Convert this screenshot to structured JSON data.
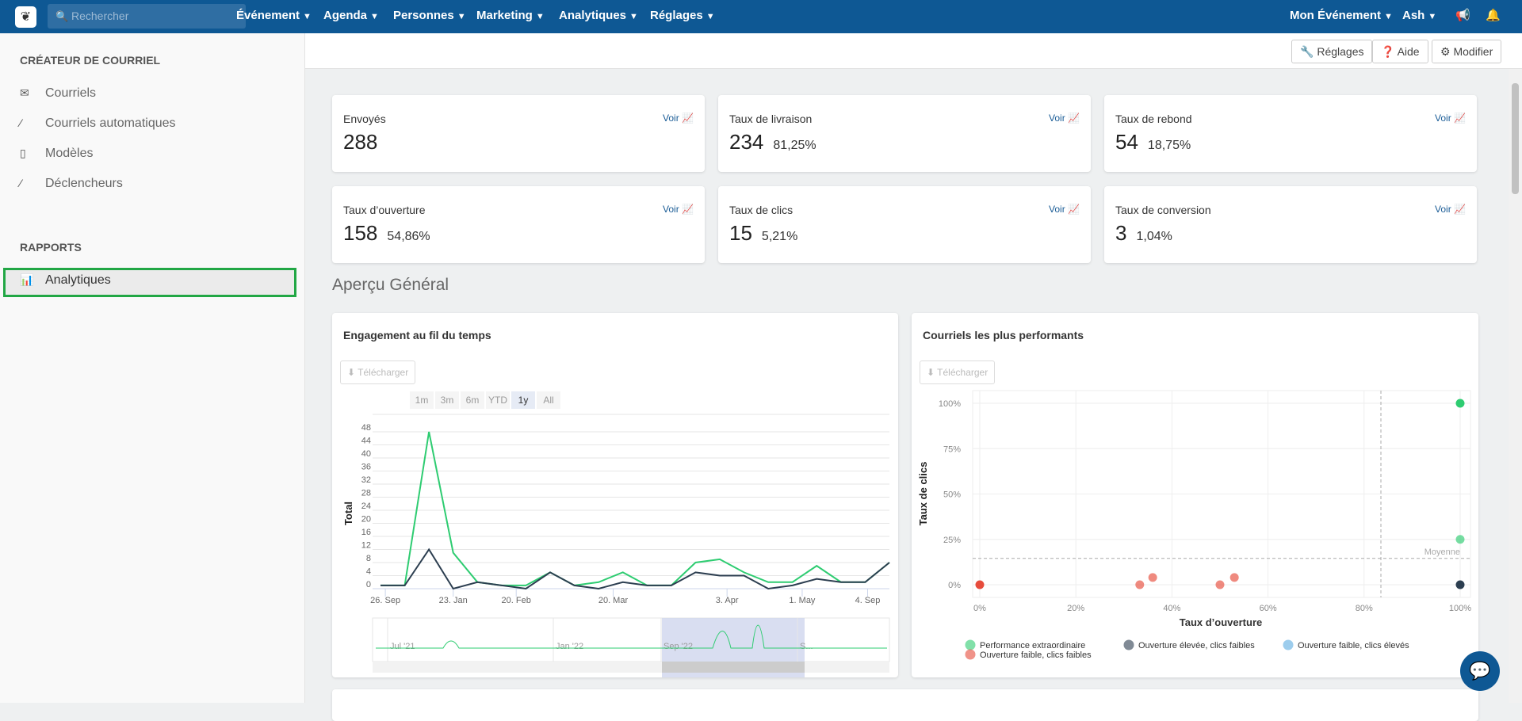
{
  "topbar": {
    "search_placeholder": "Rechercher",
    "nav": [
      "Événement",
      "Agenda",
      "Personnes",
      "Marketing",
      "Analytiques",
      "Réglages"
    ],
    "event": "Mon Événement",
    "user": "Ash"
  },
  "toolbar": {
    "settings": "Réglages",
    "help": "Aide",
    "edit": "Modifier"
  },
  "sidebar": {
    "section1": "CRÉATEUR DE COURRIEL",
    "items": [
      {
        "label": "Courriels",
        "icon": "envelope-icon"
      },
      {
        "label": "Courriels automatiques",
        "icon": "magic-wand-icon"
      },
      {
        "label": "Modèles",
        "icon": "clipboard-icon"
      },
      {
        "label": "Déclencheurs",
        "icon": "magic-wand-icon"
      }
    ],
    "section2": "RAPPORTS",
    "active": {
      "label": "Analytiques",
      "icon": "chart-icon"
    }
  },
  "stats": [
    {
      "title": "Envoyés",
      "value": "288",
      "pct": "",
      "link": "Voir"
    },
    {
      "title": "Taux de livraison",
      "value": "234",
      "pct": "81,25%",
      "link": "Voir"
    },
    {
      "title": "Taux de rebond",
      "value": "54",
      "pct": "18,75%",
      "link": "Voir"
    },
    {
      "title": "Taux d’ouverture",
      "value": "158",
      "pct": "54,86%",
      "link": "Voir"
    },
    {
      "title": "Taux de clics",
      "value": "15",
      "pct": "5,21%",
      "link": "Voir"
    },
    {
      "title": "Taux de conversion",
      "value": "3",
      "pct": "1,04%",
      "link": "Voir"
    }
  ],
  "overview_title": "Aperçu Général",
  "engagement": {
    "title": "Engagement au fil du temps",
    "download": "Télécharger",
    "ranges": [
      "1m",
      "3m",
      "6m",
      "YTD",
      "1y",
      "All"
    ],
    "selected_range": "1y",
    "navigator_labels": [
      "Jul '21",
      "Jan '22",
      "Sep '22",
      "S..."
    ]
  },
  "top_emails": {
    "title": "Courriels les plus performants",
    "download": "Télécharger",
    "avg_label": "Moyenne"
  },
  "chart_data": [
    {
      "type": "line",
      "ylabel": "Total",
      "ylim": [
        0,
        48
      ],
      "yticks": [
        0,
        4,
        8,
        12,
        16,
        20,
        24,
        28,
        32,
        36,
        40,
        44,
        48
      ],
      "grid": true,
      "xticks": [
        {
          "label": "26. Sep",
          "at": 0.2
        },
        {
          "label": "23. Jan",
          "at": 3
        },
        {
          "label": "20. Feb",
          "at": 5.6
        },
        {
          "label": "20. Mar",
          "at": 9.6
        },
        {
          "label": "3. Apr",
          "at": 14.3
        },
        {
          "label": "1. May",
          "at": 17.4
        },
        {
          "label": "4. Sep",
          "at": 20.1
        }
      ],
      "series": [
        {
          "color": "#2ecc71",
          "values": [
            1,
            1,
            48,
            11,
            2,
            1,
            1,
            5,
            1,
            2,
            5,
            1,
            1,
            8,
            9,
            5,
            2,
            2,
            7,
            2,
            2,
            8
          ]
        },
        {
          "color": "#2c3e50",
          "values": [
            1,
            1,
            12,
            0,
            2,
            1,
            0,
            5,
            1,
            0,
            2,
            1,
            1,
            5,
            4,
            4,
            0,
            1,
            3,
            2,
            2,
            8
          ]
        }
      ]
    },
    {
      "type": "scatter",
      "xlabel": "Taux d’ouverture",
      "ylabel": "Taux de clics",
      "xlim": [
        0,
        100
      ],
      "ylim": [
        0,
        100
      ],
      "xticks": [
        "0%",
        "20%",
        "40%",
        "60%",
        "80%",
        "100%"
      ],
      "yticks": [
        "0%",
        "25%",
        "50%",
        "75%",
        "100%"
      ],
      "avg_x": 83.5,
      "avg_y": 14.5,
      "legend": "bottom",
      "series": [
        {
          "name": "Performance extraordinaire",
          "color": "#2ecc71",
          "points": [
            [
              100,
              100
            ],
            [
              100,
              25
            ]
          ]
        },
        {
          "name": "Ouverture élevée, clics faibles",
          "color": "#2c3e50",
          "points": [
            [
              100,
              0
            ]
          ]
        },
        {
          "name": "Ouverture faible, clics élevés",
          "color": "#5dade2",
          "points": []
        },
        {
          "name": "Ouverture faible, clics faibles",
          "color": "#e74c3c",
          "points": [
            [
              0,
              0
            ],
            [
              33.3,
              0
            ],
            [
              36,
              4
            ],
            [
              50,
              0
            ],
            [
              53,
              4
            ]
          ]
        }
      ]
    }
  ]
}
